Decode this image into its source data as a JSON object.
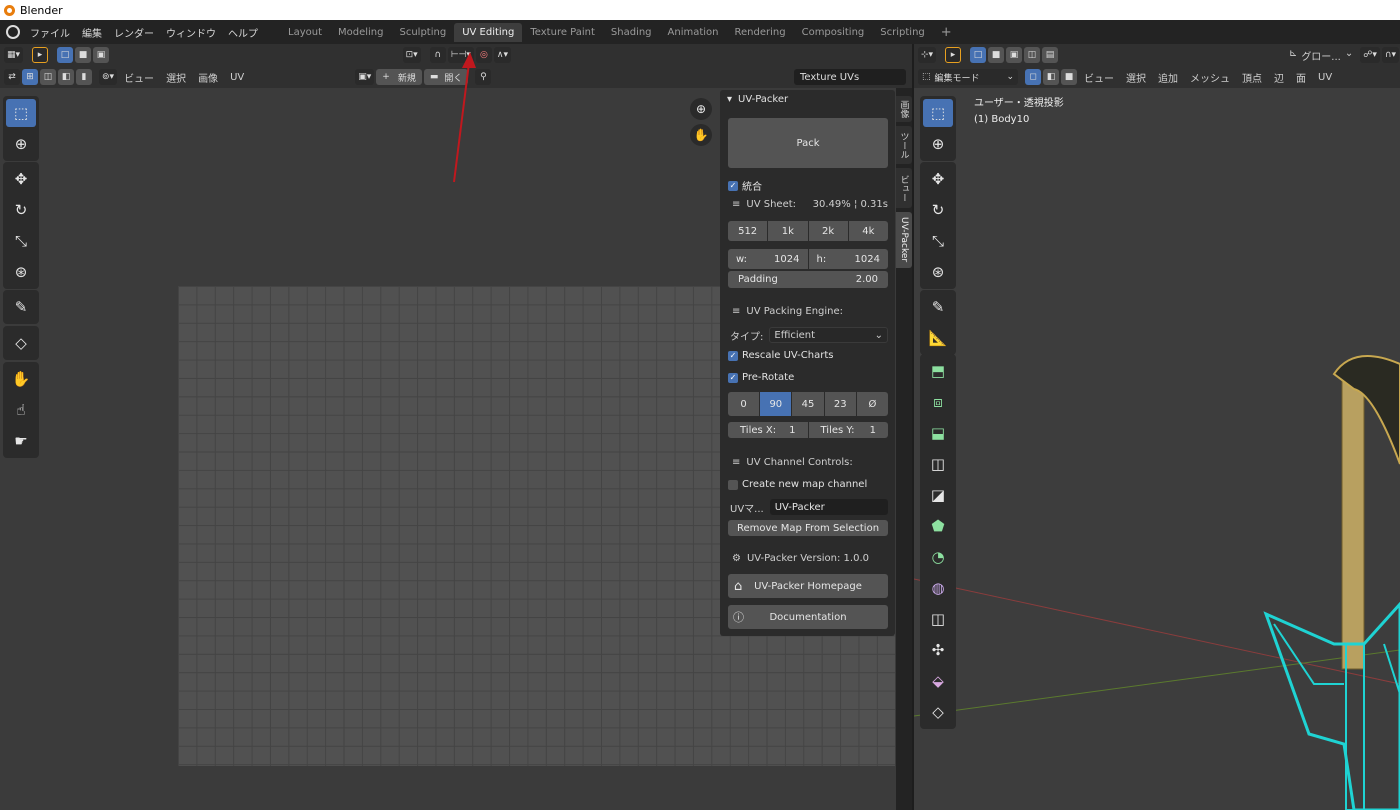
{
  "window": {
    "title": "Blender"
  },
  "menu": [
    "ファイル",
    "編集",
    "レンダー",
    "ウィンドウ",
    "ヘルプ"
  ],
  "workspaces": [
    {
      "label": "Layout",
      "active": false
    },
    {
      "label": "Modeling",
      "active": false
    },
    {
      "label": "Sculpting",
      "active": false
    },
    {
      "label": "UV Editing",
      "active": true
    },
    {
      "label": "Texture Paint",
      "active": false
    },
    {
      "label": "Shading",
      "active": false
    },
    {
      "label": "Animation",
      "active": false
    },
    {
      "label": "Rendering",
      "active": false
    },
    {
      "label": "Compositing",
      "active": false
    },
    {
      "label": "Scripting",
      "active": false
    }
  ],
  "add_workspace": "+",
  "uv_editor": {
    "header2_menu": [
      "ビュー",
      "選択",
      "画像",
      "UV"
    ],
    "new_label": "新規",
    "open_label": "開く",
    "uv_map_name": "Texture UVs",
    "new_plus": "+"
  },
  "uvpacker": {
    "title": "UV-Packer",
    "pack_label": "Pack",
    "combine_label": "統合",
    "sheet_label": "UV Sheet:",
    "sheet_stats": "30.49% ¦ 0.31s",
    "sizes": [
      "512",
      "1k",
      "2k",
      "4k"
    ],
    "w_label": "w:",
    "w_value": "1024",
    "h_label": "h:",
    "h_value": "1024",
    "padding_label": "Padding",
    "padding_value": "2.00",
    "engine_label": "UV Packing Engine:",
    "type_label": "タイプ:",
    "type_value": "Efficient",
    "rescale_label": "Rescale UV-Charts",
    "prerotate_label": "Pre-Rotate",
    "rotations": [
      "0",
      "90",
      "45",
      "23",
      "Ø"
    ],
    "active_rotation": "90",
    "tiles_x_label": "Tiles X:",
    "tiles_x_value": "1",
    "tiles_y_label": "Tiles Y:",
    "tiles_y_value": "1",
    "channel_label": "UV Channel Controls:",
    "create_channel_label": "Create new map channel",
    "uvmap_label": "UVマ...",
    "uvmap_value": "UV-Packer",
    "remove_label": "Remove Map From Selection",
    "version_label": "UV-Packer Version: 1.0.0",
    "homepage_label": "UV-Packer Homepage",
    "docs_label": "Documentation"
  },
  "side_tabs": [
    "画像",
    "ツール",
    "ビュー",
    "UV-Packer"
  ],
  "viewport": {
    "orient_label": "グロー...",
    "mode_label": "編集モード",
    "header2_menu": [
      "ビュー",
      "選択",
      "追加",
      "メッシュ",
      "頂点",
      "辺",
      "面",
      "UV"
    ],
    "view_label": "ユーザー・透視投影",
    "object_label": "(1) Body10"
  },
  "colors": {
    "accent": "#4772b3",
    "arrow": "#c0181e",
    "mesh_edge": "#1fd3d3",
    "mesh_gold": "#b8a060"
  }
}
